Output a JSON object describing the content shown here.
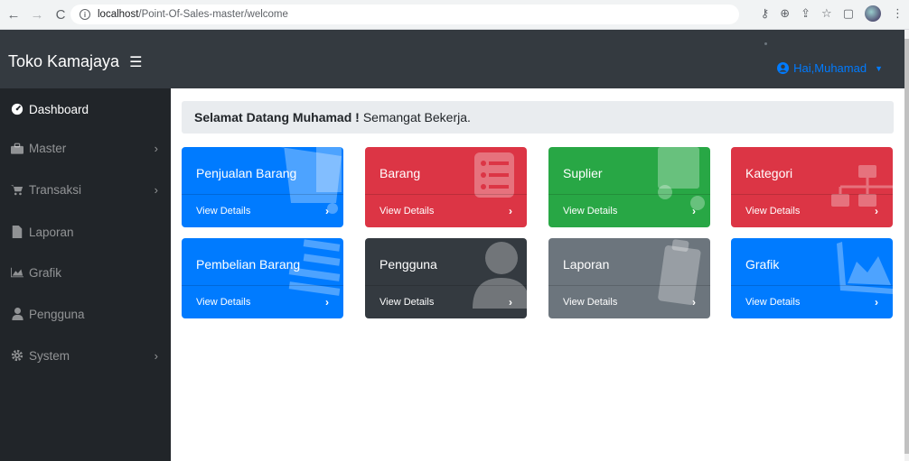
{
  "browser": {
    "url_host": "localhost",
    "url_path": "/Point-Of-Sales-master/welcome"
  },
  "navbar": {
    "brand": "Toko Kamajaya",
    "burger_icon": "☰",
    "user_label": "Hai,Muhamad"
  },
  "sidebar": {
    "items": [
      {
        "label": "Dashboard",
        "icon": "tachometer-icon",
        "has_chevron": false,
        "active": true
      },
      {
        "label": "Master",
        "icon": "briefcase-icon",
        "has_chevron": true,
        "active": false
      },
      {
        "label": "Transaksi",
        "icon": "cart-icon",
        "has_chevron": true,
        "active": false
      },
      {
        "label": "Laporan",
        "icon": "file-icon",
        "has_chevron": false,
        "active": false
      },
      {
        "label": "Grafik",
        "icon": "area-chart-icon",
        "has_chevron": false,
        "active": false
      },
      {
        "label": "Pengguna",
        "icon": "user-icon",
        "has_chevron": false,
        "active": false
      },
      {
        "label": "System",
        "icon": "cog-icon",
        "has_chevron": true,
        "active": false
      }
    ]
  },
  "welcome": {
    "bold": "Selamat Datang Muhamad !",
    "text": "Semangat Bekerja."
  },
  "cards": [
    {
      "title": "Penjualan Barang",
      "footer": "View Details",
      "color": "#007bff",
      "icon": "cart-icon"
    },
    {
      "title": "Barang",
      "footer": "View Details",
      "color": "#dc3545",
      "icon": "list-icon"
    },
    {
      "title": "Suplier",
      "footer": "View Details",
      "color": "#28a745",
      "icon": "truck-icon"
    },
    {
      "title": "Kategori",
      "footer": "View Details",
      "color": "#dc3545",
      "icon": "sitemap-icon"
    },
    {
      "title": "Pembelian Barang",
      "footer": "View Details",
      "color": "#007bff",
      "icon": "list-alt-icon"
    },
    {
      "title": "Pengguna",
      "footer": "View Details",
      "color": "#343a40",
      "icon": "user-icon"
    },
    {
      "title": "Laporan",
      "footer": "View Details",
      "color": "#6c757d",
      "icon": "clipboard-icon"
    },
    {
      "title": "Grafik",
      "footer": "View Details",
      "color": "#007bff",
      "icon": "area-chart-icon"
    }
  ],
  "card_arrow": "›"
}
